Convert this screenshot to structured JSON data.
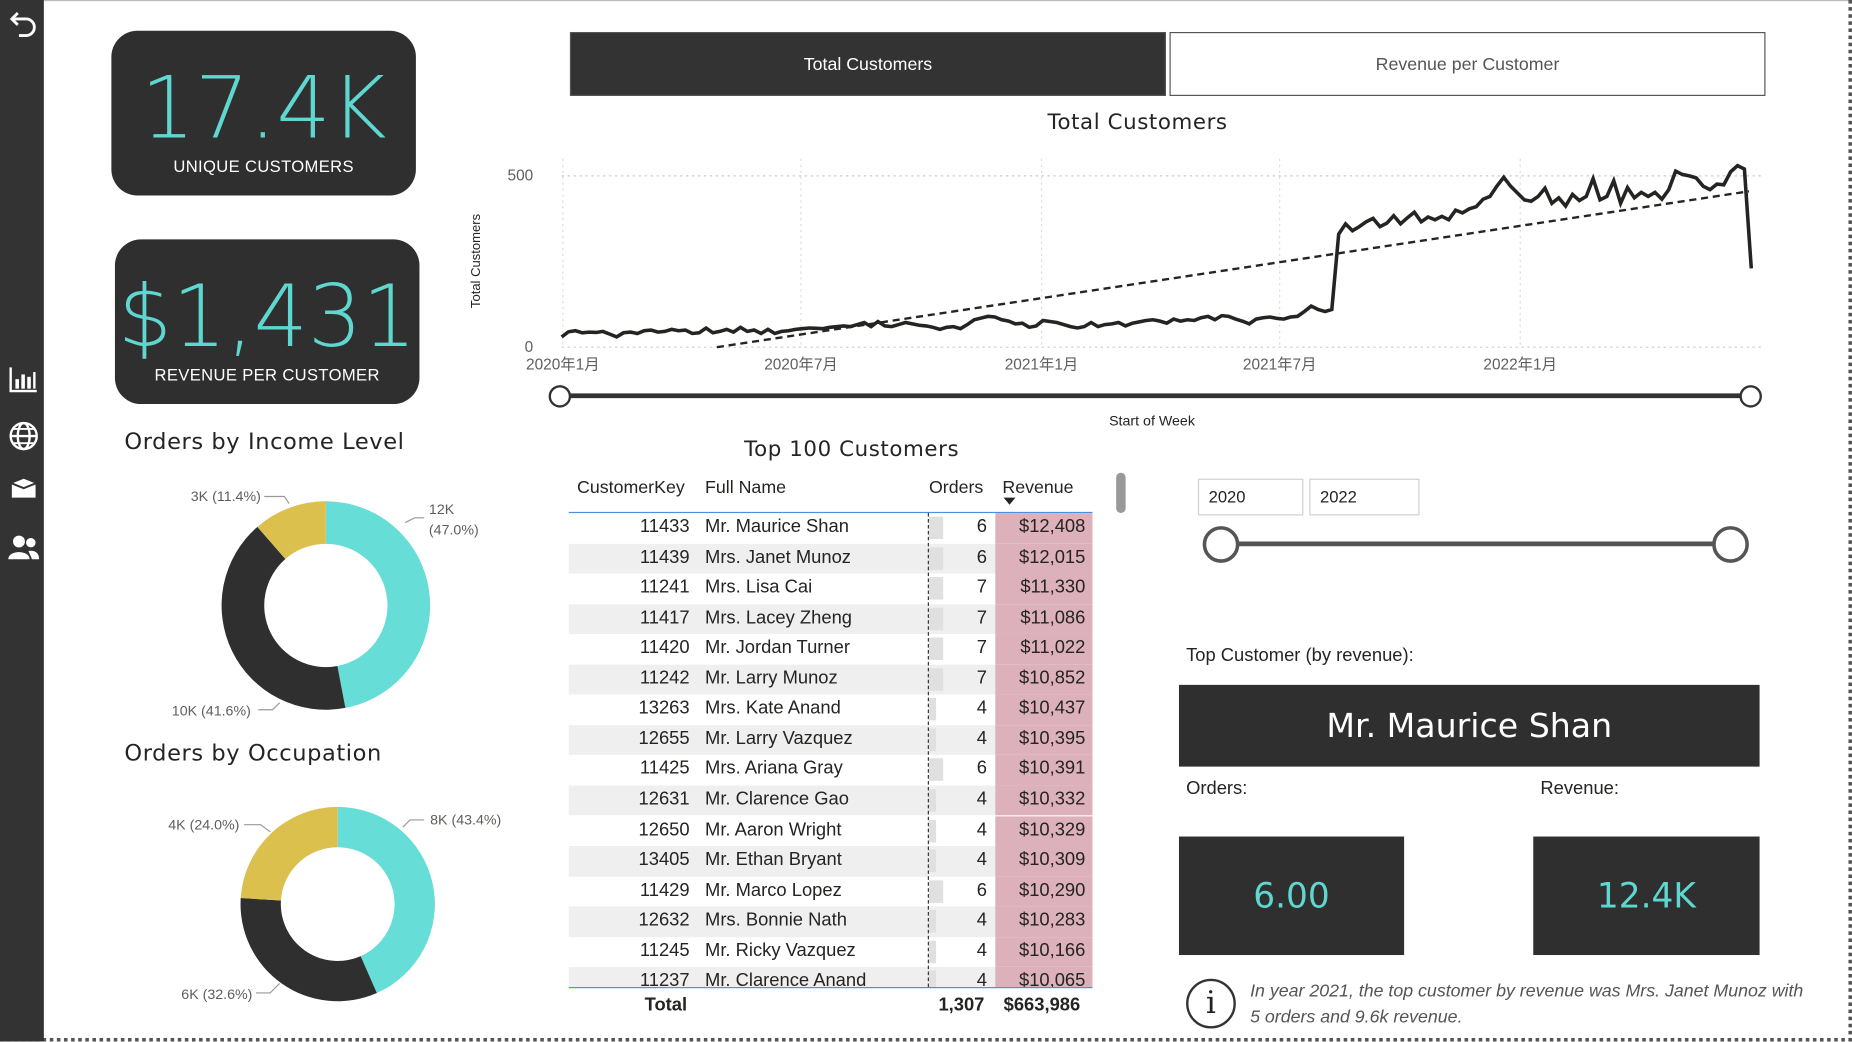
{
  "sidebar": {
    "icons": [
      "back-arrow-icon",
      "bar-chart-icon",
      "globe-icon",
      "box-icon",
      "users-icon"
    ]
  },
  "kpis": {
    "unique_customers": {
      "value": "17.4K",
      "label": "UNIQUE CUSTOMERS"
    },
    "revenue_per_customer": {
      "value": "$1,431",
      "label": "REVENUE PER CUSTOMER"
    }
  },
  "income_chart": {
    "title": "Orders by Income Level",
    "slices": [
      {
        "label": "12K",
        "pct": "(47.0%)",
        "value": 47.0,
        "color": "#66ddd6"
      },
      {
        "label": "10K (41.6%)",
        "value": 41.6,
        "color": "#2f2f2f"
      },
      {
        "label": "3K (11.4%)",
        "value": 11.4,
        "color": "#dcc04d"
      }
    ]
  },
  "occupation_chart": {
    "title": "Orders by Occupation",
    "slices": [
      {
        "label": "8K (43.4%)",
        "value": 43.4,
        "color": "#66ddd6"
      },
      {
        "label": "6K (32.6%)",
        "value": 32.6,
        "color": "#2f2f2f"
      },
      {
        "label": "4K (24.0%)",
        "value": 24.0,
        "color": "#dcc04d"
      }
    ]
  },
  "toggle": {
    "active": "Total Customers",
    "inactive": "Revenue per Customer"
  },
  "chart_data": {
    "type": "line",
    "title": "Total Customers",
    "xlabel": "Start of Week",
    "ylabel": "Total Customers",
    "x_ticks": [
      "2020年1月",
      "2020年7月",
      "2021年1月",
      "2021年7月",
      "2022年1月"
    ],
    "y_ticks": [
      "0",
      "500"
    ],
    "ylim": [
      0,
      550
    ],
    "series": [
      {
        "values": [
          30,
          45,
          48,
          42,
          44,
          43,
          46,
          38,
          30,
          42,
          44,
          40,
          48,
          50,
          44,
          46,
          52,
          48,
          50,
          40,
          42,
          56,
          42,
          46,
          52,
          44,
          58,
          46,
          50,
          40,
          52,
          40,
          46,
          48,
          52,
          54,
          56,
          55,
          54,
          58,
          60,
          62,
          60,
          66,
          72,
          60,
          75,
          62,
          60,
          66,
          72,
          68,
          64,
          62,
          58,
          52,
          58,
          60,
          54,
          66,
          80,
          85,
          90,
          88,
          80,
          76,
          68,
          70,
          58,
          62,
          78,
          75,
          72,
          66,
          60,
          56,
          60,
          72,
          60,
          66,
          68,
          72,
          62,
          70,
          74,
          78,
          80,
          76,
          70,
          82,
          76,
          80,
          78,
          86,
          90,
          80,
          92,
          90,
          82,
          76,
          68,
          82,
          86,
          88,
          84,
          82,
          88,
          90,
          104,
          120,
          110,
          104,
          110,
          330,
          360,
          340,
          352,
          366,
          376,
          352,
          362,
          384,
          360,
          378,
          394,
          366,
          380,
          372,
          382,
          372,
          400,
          392,
          404,
          410,
          432,
          440,
          470,
          496,
          470,
          450,
          430,
          426,
          440,
          464,
          420,
          436,
          412,
          446,
          428,
          440,
          492,
          430,
          440,
          486,
          420,
          466,
          436,
          452,
          440,
          452,
          432,
          460,
          514,
          504,
          500,
          494,
          470,
          460,
          476,
          474,
          512,
          530,
          520,
          230
        ]
      }
    ],
    "trend": {
      "start": 0,
      "end": 455
    }
  },
  "table": {
    "title": "Top 100 Customers",
    "columns": [
      "CustomerKey",
      "Full Name",
      "Orders",
      "Revenue"
    ],
    "rows": [
      [
        "11433",
        "Mr. Maurice Shan",
        "6",
        "$12,408"
      ],
      [
        "11439",
        "Mrs. Janet Munoz",
        "6",
        "$12,015"
      ],
      [
        "11241",
        "Mrs. Lisa Cai",
        "7",
        "$11,330"
      ],
      [
        "11417",
        "Mrs. Lacey Zheng",
        "7",
        "$11,086"
      ],
      [
        "11420",
        "Mr. Jordan Turner",
        "7",
        "$11,022"
      ],
      [
        "11242",
        "Mr. Larry Munoz",
        "7",
        "$10,852"
      ],
      [
        "13263",
        "Mrs. Kate Anand",
        "4",
        "$10,437"
      ],
      [
        "12655",
        "Mr. Larry Vazquez",
        "4",
        "$10,395"
      ],
      [
        "11425",
        "Mrs. Ariana Gray",
        "6",
        "$10,391"
      ],
      [
        "12631",
        "Mr. Clarence Gao",
        "4",
        "$10,332"
      ],
      [
        "12650",
        "Mr. Aaron Wright",
        "4",
        "$10,329"
      ],
      [
        "13405",
        "Mr. Ethan Bryant",
        "4",
        "$10,309"
      ],
      [
        "11429",
        "Mr. Marco Lopez",
        "6",
        "$10,290"
      ],
      [
        "12632",
        "Mrs. Bonnie Nath",
        "4",
        "$10,283"
      ],
      [
        "11245",
        "Mr. Ricky Vazquez",
        "4",
        "$10,166"
      ],
      [
        "11237",
        "Mr. Clarence Anand",
        "4",
        "$10,065"
      ]
    ],
    "total": {
      "label": "Total",
      "orders": "1,307",
      "revenue": "$663,986"
    }
  },
  "year_filter": {
    "from": "2020",
    "to": "2022"
  },
  "top_customer": {
    "heading": "Top Customer (by revenue):",
    "name": "Mr. Maurice Shan",
    "orders_label": "Orders:",
    "orders_value": "6.00",
    "revenue_label": "Revenue:",
    "revenue_value": "12.4K",
    "note": "In year 2021, the top customer by revenue was Mrs. Janet Munoz with 5 orders and 9.6k revenue."
  },
  "colors": {
    "teal": "#5fd7d0",
    "dark": "#2f2f2f",
    "gold": "#dcc04d",
    "revenue_highlight": "#dcb1bb"
  }
}
